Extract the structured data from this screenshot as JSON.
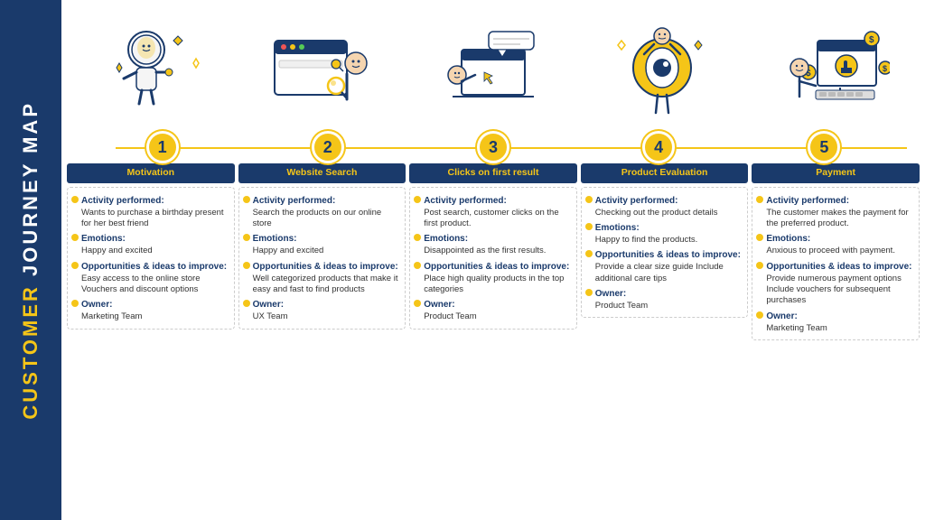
{
  "sidebar": {
    "line1": "CUSTOMER",
    "line2": " JOURNEY MAP"
  },
  "steps": [
    {
      "number": "1",
      "header": "Motivation",
      "activity_title": "Activity performed:",
      "activity_text": "Wants to purchase a birthday present for her best friend",
      "emotions_title": "Emotions:",
      "emotions_text": "Happy and excited",
      "opps_title": "Opportunities & ideas to improve:",
      "opps_text": "Easy access to the online store\nVouchers and discount options",
      "owner_title": "Owner:",
      "owner_text": "Marketing Team"
    },
    {
      "number": "2",
      "header": "Website Search",
      "activity_title": "Activity performed:",
      "activity_text": "Search the products on our online store",
      "emotions_title": "Emotions:",
      "emotions_text": "Happy and excited",
      "opps_title": "Opportunities & ideas to improve:",
      "opps_text": "Well categorized products that make it easy and fast to find products",
      "owner_title": "Owner:",
      "owner_text": "UX Team"
    },
    {
      "number": "3",
      "header": "Clicks on first result",
      "activity_title": "Activity performed:",
      "activity_text": "Post search, customer clicks on the first product.",
      "emotions_title": "Emotions:",
      "emotions_text": "Disappointed as the first results.",
      "opps_title": "Opportunities & ideas to improve:",
      "opps_text": "Place high quality products in the top categories",
      "owner_title": "Owner:",
      "owner_text": "Product Team"
    },
    {
      "number": "4",
      "header": "Product Evaluation",
      "activity_title": "Activity performed:",
      "activity_text": "Checking out the product details",
      "emotions_title": "Emotions:",
      "emotions_text": "Happy to find the products.",
      "opps_title": "Opportunities & ideas to improve:",
      "opps_text": "Provide a clear size guide\nInclude additional care tips",
      "owner_title": "Owner:",
      "owner_text": "Product Team"
    },
    {
      "number": "5",
      "header": "Payment",
      "activity_title": "Activity performed:",
      "activity_text": "The customer makes the payment for the preferred product.",
      "emotions_title": "Emotions:",
      "emotions_text": "Anxious to proceed with payment.",
      "opps_title": "Opportunities & ideas to improve:",
      "opps_text": "Provide numerous payment options\nInclude vouchers for subsequent purchases",
      "owner_title": "Owner:",
      "owner_text": "Marketing Team"
    }
  ]
}
